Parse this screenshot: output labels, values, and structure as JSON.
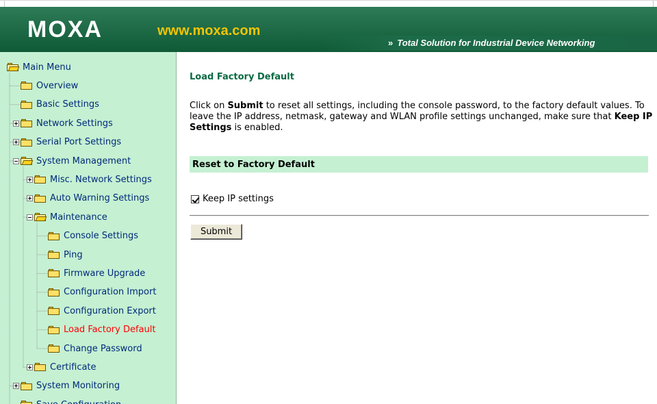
{
  "header": {
    "logo": "MOXA",
    "url": "www.moxa.com",
    "tagline": "Total Solution for Industrial Device Networking",
    "tagline_arrow": "»"
  },
  "sidebar": {
    "root": "Main Menu",
    "items": [
      {
        "label": "Overview",
        "depth": 1,
        "expander": "none",
        "open": false
      },
      {
        "label": "Basic Settings",
        "depth": 1,
        "expander": "none",
        "open": false
      },
      {
        "label": "Network Settings",
        "depth": 1,
        "expander": "plus",
        "open": false
      },
      {
        "label": "Serial Port Settings",
        "depth": 1,
        "expander": "plus",
        "open": false
      },
      {
        "label": "System Management",
        "depth": 1,
        "expander": "minus",
        "open": true
      },
      {
        "label": "Misc. Network Settings",
        "depth": 2,
        "expander": "plus",
        "open": false
      },
      {
        "label": "Auto Warning Settings",
        "depth": 2,
        "expander": "plus",
        "open": false
      },
      {
        "label": "Maintenance",
        "depth": 2,
        "expander": "minus",
        "open": true
      },
      {
        "label": "Console Settings",
        "depth": 3,
        "expander": "none",
        "open": false
      },
      {
        "label": "Ping",
        "depth": 3,
        "expander": "none",
        "open": false
      },
      {
        "label": "Firmware Upgrade",
        "depth": 3,
        "expander": "none",
        "open": false
      },
      {
        "label": "Configuration Import",
        "depth": 3,
        "expander": "none",
        "open": false
      },
      {
        "label": "Configuration Export",
        "depth": 3,
        "expander": "none",
        "open": false
      },
      {
        "label": "Load Factory Default",
        "depth": 3,
        "expander": "none",
        "open": false,
        "active": true
      },
      {
        "label": "Change Password",
        "depth": 3,
        "expander": "none",
        "open": false
      },
      {
        "label": "Certificate",
        "depth": 2,
        "expander": "plus",
        "open": false
      },
      {
        "label": "System Monitoring",
        "depth": 1,
        "expander": "plus",
        "open": false
      },
      {
        "label": "Save Configuration",
        "depth": 1,
        "expander": "none",
        "open": false
      }
    ]
  },
  "main": {
    "title": "Load Factory Default",
    "description": {
      "p1": "Click on ",
      "b1": "Submit",
      "p2": " to reset all settings, including the console password, to the factory default values. To leave the IP address, netmask, gateway and WLAN profile settings unchanged, make sure that ",
      "b2": "Keep IP Settings",
      "p3": " is enabled."
    },
    "section_title": "Reset to Factory Default",
    "keep_ip_label": "Keep IP settings",
    "keep_ip_checked": true,
    "submit_label": "Submit"
  },
  "colors": {
    "header_green": "#0f5a36",
    "url_yellow": "#f2c400",
    "sidebar_bg": "#c5f0d2",
    "nav_text": "#002a7a",
    "active_red": "#ff0000",
    "title_green": "#0a6a43"
  }
}
